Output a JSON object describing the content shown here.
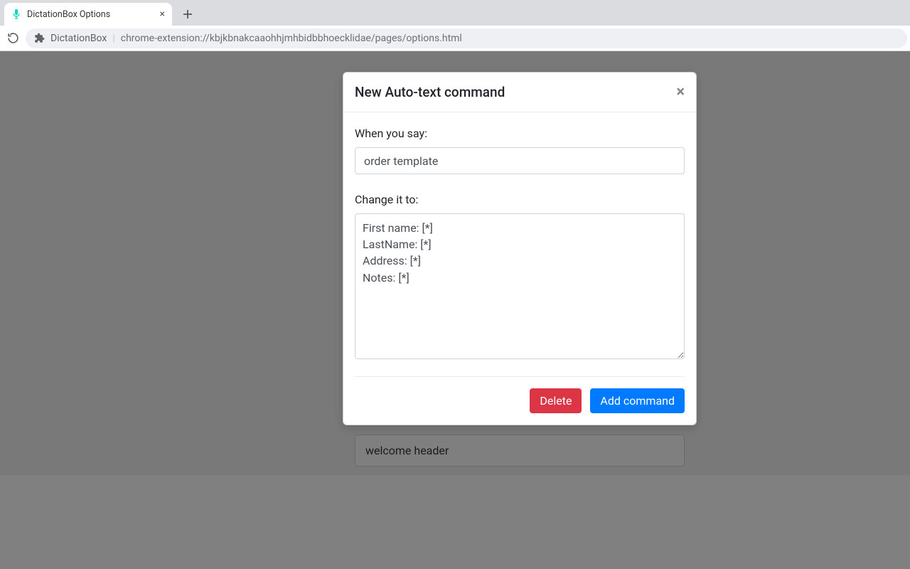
{
  "browser": {
    "tab_title": "DictationBox Options",
    "address_extension_name": "DictationBox",
    "address_url": "chrome-extension://kbjkbnakcaaohhjmhbidbbhoecklidae/pages/options.html"
  },
  "modal": {
    "title": "New Auto-text command",
    "when_label": "When you say:",
    "when_value": "order template",
    "change_label": "Change it to:",
    "change_value": "First name: [*]\nLastName: [*]\nAddress: [*]\nNotes: [*]",
    "delete_label": "Delete",
    "add_label": "Add command"
  },
  "background": {
    "visible_item": "welcome header"
  },
  "colors": {
    "primary": "#007bff",
    "danger": "#dc3545",
    "mic_accent": "#00d6c2"
  }
}
